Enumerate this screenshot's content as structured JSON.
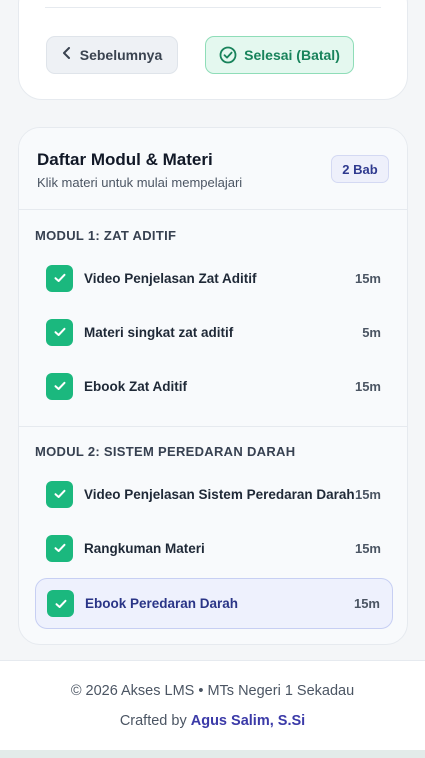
{
  "nav": {
    "prev_label": "Sebelumnya",
    "done_label": "Selesai (Batal)"
  },
  "course_list": {
    "title": "Daftar Modul & Materi",
    "subtitle": "Klik materi untuk mulai mempelajari",
    "badge": "2 Bab",
    "modules": [
      {
        "title": "MODUL 1: ZAT ADITIF",
        "items": [
          {
            "label": "Video Penjelasan Zat Aditif",
            "duration": "15m",
            "completed": true
          },
          {
            "label": "Materi singkat zat aditif",
            "duration": "5m",
            "completed": true
          },
          {
            "label": "Ebook Zat Aditif",
            "duration": "15m",
            "completed": true
          }
        ]
      },
      {
        "title": "MODUL 2: SISTEM PEREDARAN DARAH",
        "items": [
          {
            "label": "Video Penjelasan Sistem Peredaran Darah",
            "duration": "15m",
            "completed": true
          },
          {
            "label": "Rangkuman Materi",
            "duration": "15m",
            "completed": true
          },
          {
            "label": "Ebook Peredaran Darah",
            "duration": "15m",
            "completed": true,
            "active": true
          }
        ]
      }
    ]
  },
  "footer": {
    "copyright": "© 2026 Akses LMS • MTs Negeri 1 Sekadau",
    "crafted_prefix": "Crafted by",
    "author": "Agus Salim, S.Si"
  },
  "colors": {
    "accent_green": "#1bb87e",
    "accent_indigo": "#3b3aa8"
  },
  "icons": {
    "prev": "chevron-left-icon",
    "done": "check-circle-icon",
    "item_check": "checkbox-checked-icon"
  }
}
